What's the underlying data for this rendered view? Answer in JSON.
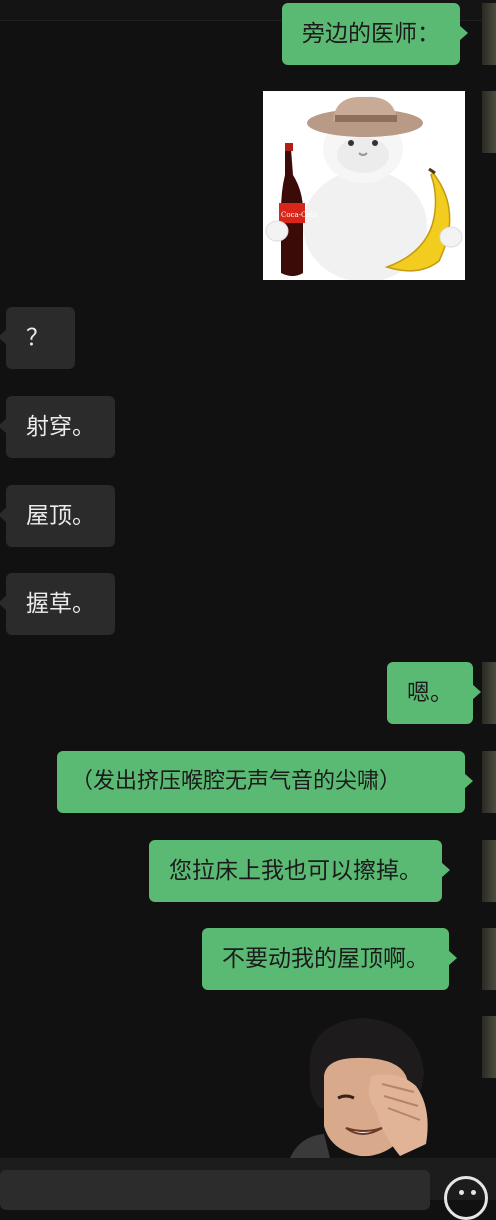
{
  "messages": [
    {
      "side": "out",
      "text": "旁边的医师："
    },
    {
      "side": "out",
      "sticker": "cat-with-cola-and-banana"
    },
    {
      "side": "in",
      "text": "？"
    },
    {
      "side": "in",
      "text": "射穿。"
    },
    {
      "side": "in",
      "text": "屋顶。"
    },
    {
      "side": "in",
      "text": "握草。"
    },
    {
      "side": "out",
      "text": "嗯。"
    },
    {
      "side": "out",
      "text": "（发出挤压喉腔无声气音的尖啸）"
    },
    {
      "side": "out",
      "text": "您拉床上我也可以擦掉。"
    },
    {
      "side": "out",
      "text": "不要动我的屋顶啊。"
    },
    {
      "side": "out",
      "sticker": "facepalm-person"
    }
  ],
  "sticker_labels": {
    "cola_brand": "Coca-Cola"
  },
  "input": {
    "emoji_icon": "smiley-face-icon"
  },
  "colors": {
    "background": "#111111",
    "outgoing_bubble": "#5aba73",
    "incoming_bubble": "#2b2b2b"
  }
}
